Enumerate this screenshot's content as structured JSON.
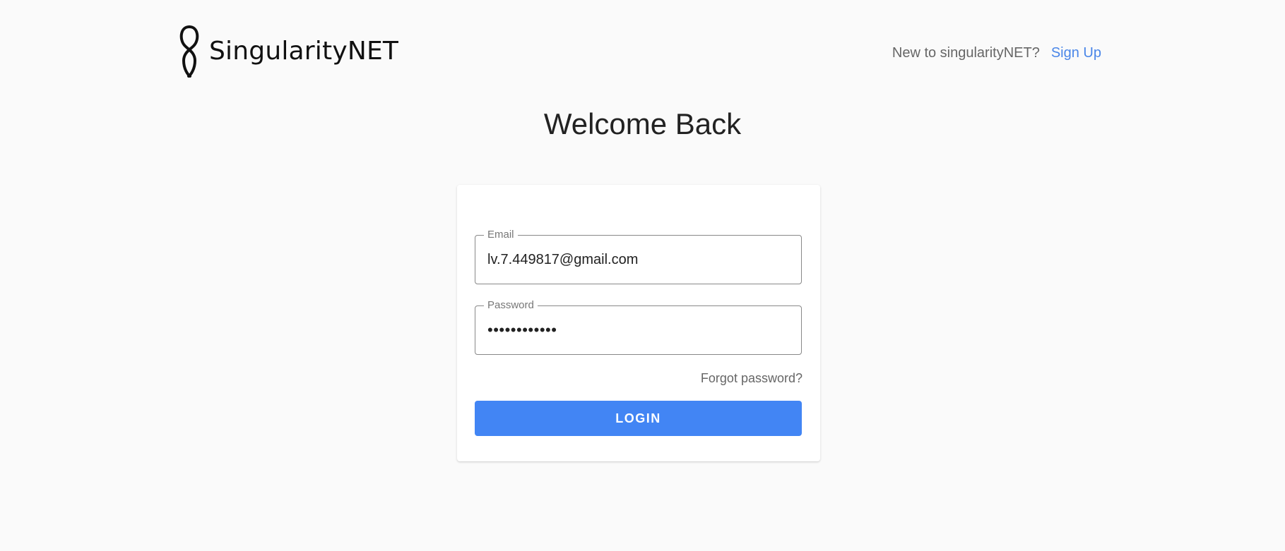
{
  "brand": {
    "name": "SingularityNET",
    "logo_icon": "singularitynet-logo-icon"
  },
  "header": {
    "signup_prompt": "New to singularityNET?",
    "signup_link": "Sign Up"
  },
  "main": {
    "title": "Welcome Back"
  },
  "login_form": {
    "email_label": "Email",
    "email_value": "lv.7.449817@gmail.com",
    "password_label": "Password",
    "password_value": "••••••••••••",
    "forgot_password": "Forgot password?",
    "login_button": "LOGIN"
  },
  "colors": {
    "background": "#fafafa",
    "accent": "#4285f4",
    "link": "#4a86e8"
  }
}
